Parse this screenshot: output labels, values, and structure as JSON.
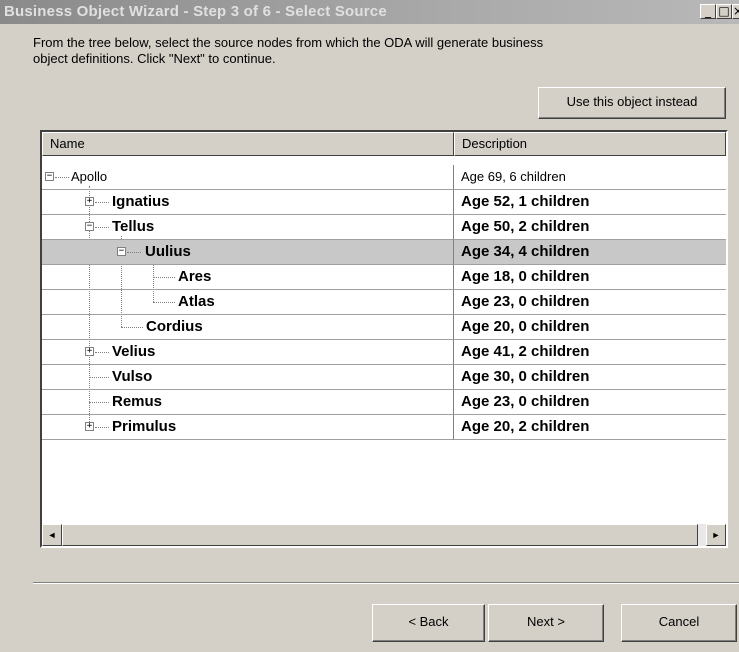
{
  "window": {
    "title": "Business Object Wizard - Step 3 of 6 - Select Source",
    "controls": {
      "minimize": "_",
      "maximize": "□",
      "close": "×"
    }
  },
  "intro": {
    "line1": "From the tree below, select the source nodes from which the ODA will generate business",
    "line2": "object definitions. Click \"Next\" to continue."
  },
  "use_button_label": "Use this object instead",
  "grid": {
    "columns": {
      "name": "Name",
      "description": "Description"
    },
    "rows": [
      {
        "name": "Apollo",
        "description": "Age 69, 6 children"
      },
      {
        "name": "Ignatius",
        "description": "Age 52, 1 children"
      },
      {
        "name": "Tellus",
        "description": "Age 50, 2 children"
      },
      {
        "name": "Uulius",
        "description": "Age 34, 4 children"
      },
      {
        "name": "Ares",
        "description": "Age 18, 0 children"
      },
      {
        "name": "Atlas",
        "description": "Age 23, 0 children"
      },
      {
        "name": "Cordius",
        "description": "Age 20, 0 children"
      },
      {
        "name": "Velius",
        "description": "Age 41, 2 children"
      },
      {
        "name": "Vulso",
        "description": "Age 30, 0 children"
      },
      {
        "name": "Remus",
        "description": "Age 23, 0 children"
      },
      {
        "name": "Primulus",
        "description": "Age 20, 2 children"
      }
    ],
    "expanders": {
      "collapse": "−",
      "expand": "+"
    },
    "scroll": {
      "left": "◄",
      "right": "►"
    }
  },
  "buttons": {
    "back": "< Back",
    "next": "Next >",
    "cancel": "Cancel"
  }
}
